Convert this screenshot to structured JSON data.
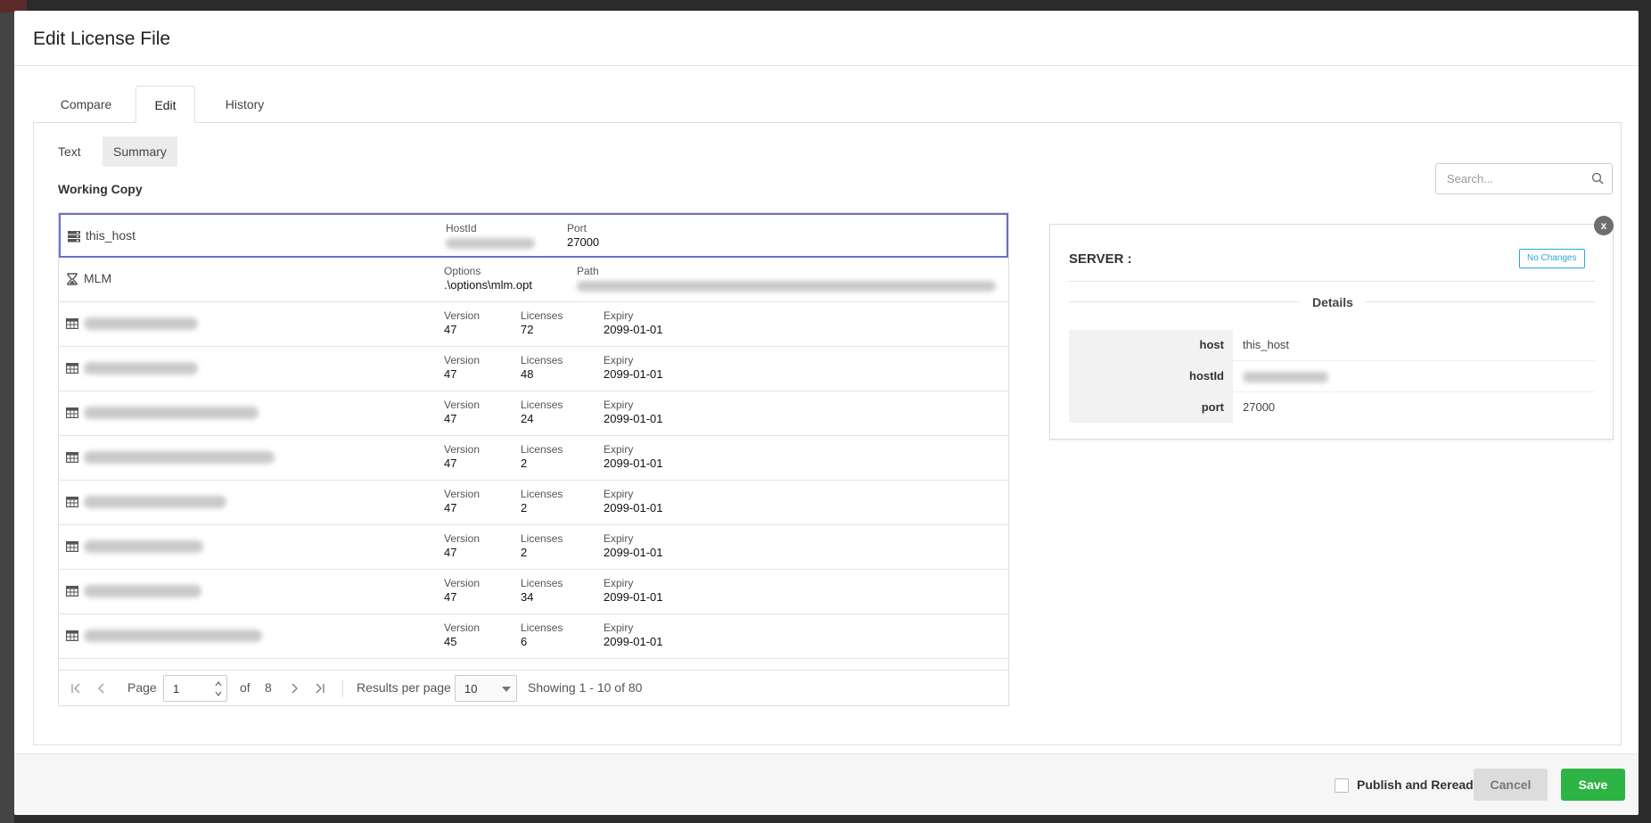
{
  "modal": {
    "title": "Edit License File"
  },
  "tabs": [
    {
      "label": "Compare"
    },
    {
      "label": "Edit"
    },
    {
      "label": "History"
    }
  ],
  "active_tab": "Edit",
  "subtabs": [
    {
      "label": "Text"
    },
    {
      "label": "Summary"
    }
  ],
  "active_subtab": "Summary",
  "section_title": "Working Copy",
  "search": {
    "placeholder": "Search..."
  },
  "rows": {
    "server": {
      "name": "this_host",
      "hostid_label": "HostId",
      "port_label": "Port",
      "port_value": "27000",
      "icon": "server-icon"
    },
    "vendor": {
      "name": "MLM",
      "options_label": "Options",
      "options_value": ".\\options\\mlm.opt",
      "path_label": "Path",
      "icon": "hourglass-icon"
    },
    "features": [
      {
        "version_label": "Version",
        "version": "47",
        "licenses_label": "Licenses",
        "licenses": "72",
        "expiry_label": "Expiry",
        "expiry": "2099-01-01"
      },
      {
        "version_label": "Version",
        "version": "47",
        "licenses_label": "Licenses",
        "licenses": "48",
        "expiry_label": "Expiry",
        "expiry": "2099-01-01"
      },
      {
        "version_label": "Version",
        "version": "47",
        "licenses_label": "Licenses",
        "licenses": "24",
        "expiry_label": "Expiry",
        "expiry": "2099-01-01"
      },
      {
        "version_label": "Version",
        "version": "47",
        "licenses_label": "Licenses",
        "licenses": "2",
        "expiry_label": "Expiry",
        "expiry": "2099-01-01"
      },
      {
        "version_label": "Version",
        "version": "47",
        "licenses_label": "Licenses",
        "licenses": "2",
        "expiry_label": "Expiry",
        "expiry": "2099-01-01"
      },
      {
        "version_label": "Version",
        "version": "47",
        "licenses_label": "Licenses",
        "licenses": "2",
        "expiry_label": "Expiry",
        "expiry": "2099-01-01"
      },
      {
        "version_label": "Version",
        "version": "47",
        "licenses_label": "Licenses",
        "licenses": "34",
        "expiry_label": "Expiry",
        "expiry": "2099-01-01"
      },
      {
        "version_label": "Version",
        "version": "45",
        "licenses_label": "Licenses",
        "licenses": "6",
        "expiry_label": "Expiry",
        "expiry": "2099-01-01"
      }
    ]
  },
  "pager": {
    "page_label": "Page",
    "page_value": "1",
    "of_label": "of",
    "total_pages": "8",
    "results_label": "Results per page",
    "per_page": "10",
    "showing": "Showing 1 - 10 of 80"
  },
  "detail": {
    "close_label": "x",
    "heading": "SERVER :",
    "badge": "No Changes",
    "details_label": "Details",
    "rows": [
      {
        "key": "host",
        "value": "this_host"
      },
      {
        "key": "hostId",
        "value": ""
      },
      {
        "key": "port",
        "value": "27000"
      }
    ]
  },
  "footer": {
    "publish_label": "Publish and Reread",
    "cancel_label": "Cancel",
    "save_label": "Save"
  },
  "colors": {
    "accent_selected": "#6b6fc7",
    "save_green": "#2db444",
    "badge_blue": "#2aa5d8"
  }
}
